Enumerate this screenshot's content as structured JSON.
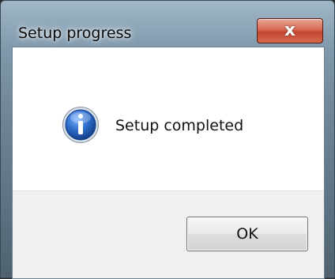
{
  "window": {
    "title": "Setup progress",
    "close_label": "x"
  },
  "dialog": {
    "icon": "information-icon",
    "message": "Setup completed",
    "ok_label": "OK"
  },
  "colors": {
    "icon_blue": "#1e5fb0",
    "close_red": "#c24731"
  }
}
